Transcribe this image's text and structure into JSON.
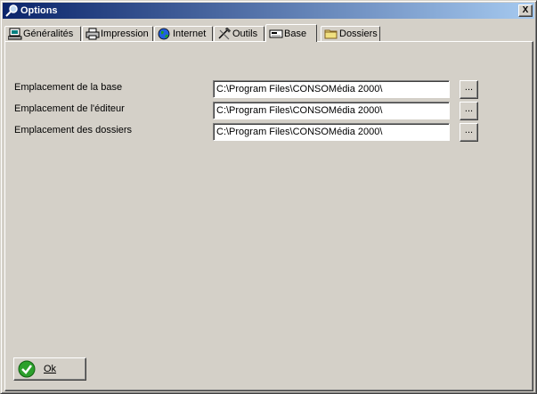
{
  "window": {
    "title": "Options",
    "close_label": "X"
  },
  "tabs": [
    {
      "label": "Généralités",
      "icon": "computer-icon"
    },
    {
      "label": "Impression",
      "icon": "printer-icon"
    },
    {
      "label": "Internet",
      "icon": "globe-icon"
    },
    {
      "label": "Outils",
      "icon": "tools-icon"
    },
    {
      "label": "Base",
      "icon": "database-icon",
      "active": true
    },
    {
      "label": "Dossiers",
      "icon": "folder-icon"
    }
  ],
  "rows": [
    {
      "label": "Emplacement de la base",
      "value": "C:\\Program Files\\CONSOMédia 2000\\",
      "button": "..."
    },
    {
      "label": "Emplacement de l'éditeur",
      "value": "C:\\Program Files\\CONSOMédia 2000\\",
      "button": "..."
    },
    {
      "label": "Emplacement des dossiers",
      "value": "C:\\Program Files\\CONSOMédia 2000\\",
      "button": "..."
    }
  ],
  "ok_button": {
    "label": "Ok",
    "icon": "check-icon"
  },
  "colors": {
    "titlebar_start": "#0a246a",
    "titlebar_end": "#a6caf0",
    "face": "#d4d0c8"
  }
}
